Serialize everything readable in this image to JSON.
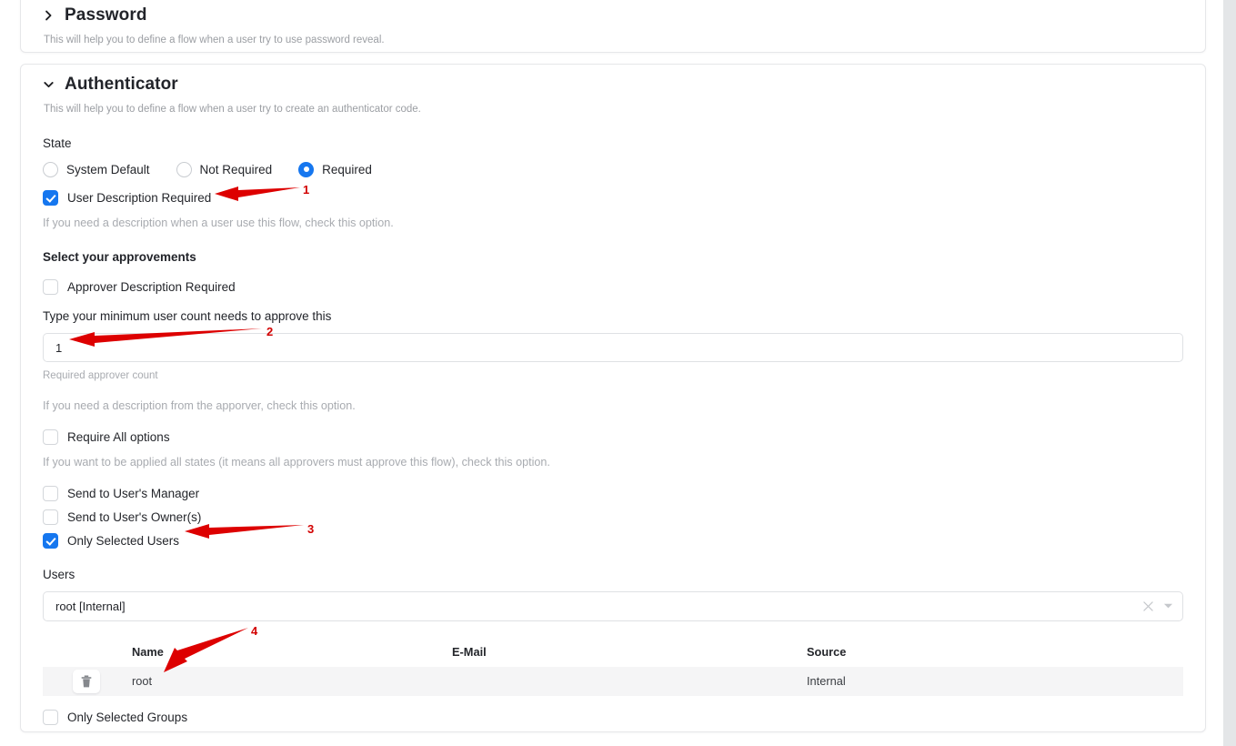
{
  "sections": [
    {
      "id": "password",
      "title": "Password",
      "subtitle": "This will help you to define a flow when a user try to use password reveal.",
      "expanded": false,
      "chevron_icon": "chevron-right-icon"
    },
    {
      "id": "authenticator",
      "title": "Authenticator",
      "subtitle": "This will help you to define a flow when a user try to create an authenticator code.",
      "expanded": true,
      "chevron_icon": "chevron-down-icon"
    }
  ],
  "authenticator": {
    "state": {
      "label": "State",
      "options": [
        {
          "label": "System Default",
          "selected": false
        },
        {
          "label": "Not Required",
          "selected": false
        },
        {
          "label": "Required",
          "selected": true
        }
      ]
    },
    "user_description_required": {
      "label": "User Description Required",
      "checked": true,
      "help": "If you need a description when a user use this flow, check this option."
    },
    "approvements_heading": "Select your approvements",
    "approver_description_required": {
      "label": "Approver Description Required",
      "checked": false
    },
    "min_user_count": {
      "label": "Type your minimum user count needs to approve this",
      "value": "1",
      "placeholder": "",
      "helper": "Required approver count"
    },
    "approver_description_help": "If you need a description from the apporver, check this option.",
    "require_all": {
      "label": "Require All options",
      "checked": false,
      "help": "If you want to be applied all states (it means all approvers must approve this flow), check this option."
    },
    "targets": [
      {
        "label": "Send to User's Manager",
        "checked": false
      },
      {
        "label": "Send to User's Owner(s)",
        "checked": false
      },
      {
        "label": "Only Selected Users",
        "checked": true
      }
    ],
    "users_select": {
      "label": "Users",
      "value": "root [Internal]",
      "clear_icon": "close-icon",
      "caret_icon": "chevron-down-icon"
    },
    "users_table": {
      "columns": [
        "",
        "Name",
        "E-Mail",
        "Source"
      ],
      "rows": [
        {
          "action_icon": "trash-icon",
          "name": "root",
          "email": "",
          "source": "Internal"
        }
      ]
    },
    "only_selected_groups": {
      "label": "Only Selected Groups",
      "checked": false
    }
  },
  "annotations": [
    {
      "number": "1",
      "target": "user-description-required-checkbox"
    },
    {
      "number": "2",
      "target": "min-user-count-input"
    },
    {
      "number": "3",
      "target": "only-selected-users-checkbox"
    },
    {
      "number": "4",
      "target": "users-table-name-cell"
    }
  ],
  "colors": {
    "accent": "#1677ef",
    "annotation": "#d20000",
    "row_background": "#f5f5f6",
    "muted_text": "#a8abb0"
  }
}
